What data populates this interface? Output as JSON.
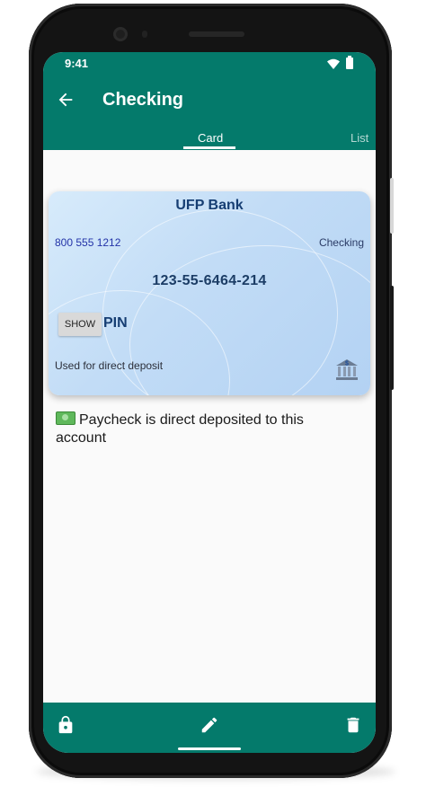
{
  "status_bar": {
    "time": "9:41"
  },
  "app_bar": {
    "title": "Checking"
  },
  "tabs": [
    {
      "label": "Card",
      "selected": true
    },
    {
      "label": "List",
      "selected": false
    }
  ],
  "card": {
    "bank_name": "UFP Bank",
    "phone": "800 555 1212",
    "account_type": "Checking",
    "account_number": "123-55-6464-214",
    "show_button": "SHOW",
    "pin_label": "PIN",
    "note": "Used for direct deposit",
    "icon": "bank-icon"
  },
  "body": {
    "note_icon": "money-icon",
    "note_text": "Paycheck is direct deposited to this account"
  },
  "bottom_bar": {
    "icons": [
      "lock-icon",
      "edit-icon",
      "delete-icon"
    ]
  },
  "colors": {
    "primary": "#047a6b",
    "card_text": "#163e73",
    "phone_link": "#2333a8"
  }
}
